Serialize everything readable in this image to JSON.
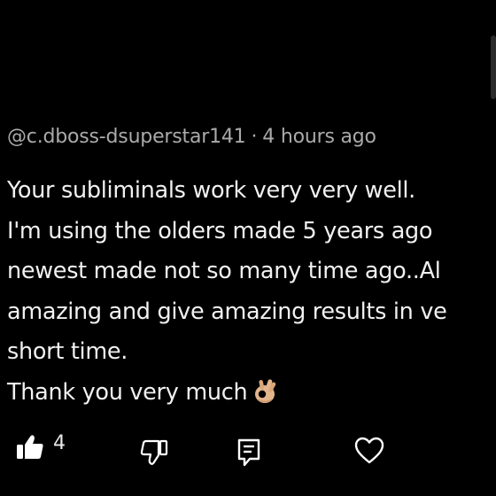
{
  "comment": {
    "author": "@c.dboss-dsuperstar141",
    "separator": "·",
    "time": "4 hours ago",
    "lines": [
      "Your subliminals work very very well.",
      "I'm using the olders made 5 years ago",
      "newest made not so many time ago..Al",
      "amazing and give amazing results in ve",
      "short time.",
      "Thank you very much"
    ],
    "emoji": "ok-hand-emoji"
  },
  "actions": {
    "like_count": "4",
    "icons": [
      "thumbs-up-icon",
      "thumbs-down-icon",
      "reply-icon",
      "heart-icon"
    ]
  },
  "colors": {
    "background": "#000000",
    "meta_text": "#aaaaaa",
    "body_text": "#f1f1f1",
    "emoji_skin": "#e3b58c"
  }
}
